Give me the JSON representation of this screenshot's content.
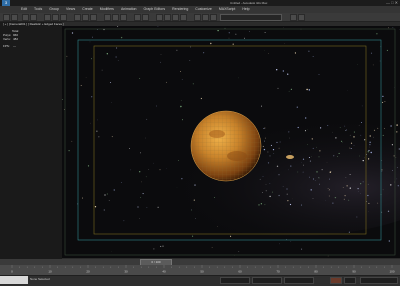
{
  "app": {
    "icon_label": "3",
    "title": "Untitled - Autodesk 3ds Max",
    "window_controls": "— □ ✕"
  },
  "menu": [
    "Edit",
    "Tools",
    "Group",
    "Views",
    "Create",
    "Modifiers",
    "Animation",
    "Graph Editors",
    "Rendering",
    "Customize",
    "MAXScript",
    "Help"
  ],
  "viewport": {
    "label": "[ + ] [Camera001 ] [ Realistic + Edged Faces ]",
    "stats": {
      "header": "Total",
      "polys_label": "Polys:",
      "polys_value": "960",
      "verts_label": "Verts:",
      "verts_value": "482",
      "fps_label": "FPS:",
      "fps_value": "—"
    },
    "colors": {
      "background": "#0b0b0d",
      "planet": "#c8822a",
      "safe_frame_outer": "#7a6a1e",
      "safe_frame_inner": "#2f8a8f"
    }
  },
  "timeline": {
    "slider_label": "0 / 100",
    "ticks": [
      "0",
      "10",
      "20",
      "30",
      "40",
      "50",
      "60",
      "70",
      "80",
      "90",
      "100"
    ]
  },
  "status": {
    "message": "None Selected"
  }
}
